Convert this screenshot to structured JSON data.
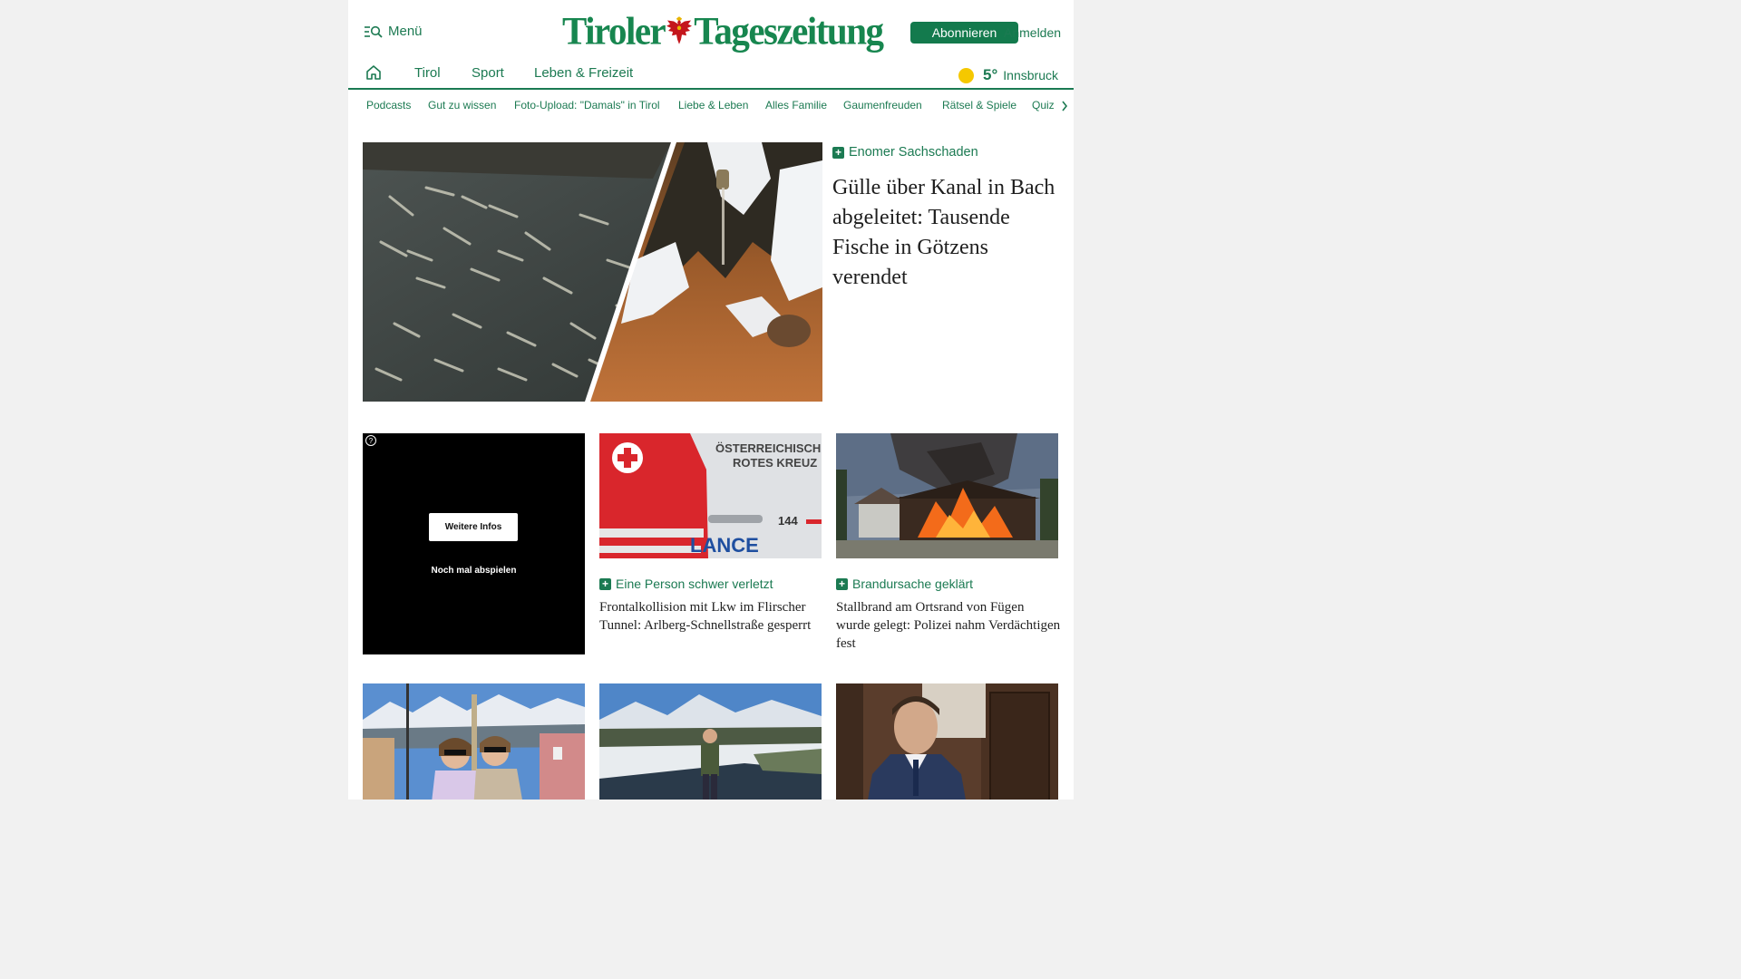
{
  "header": {
    "menu_label": "Menü",
    "logo_part1": "Tiroler",
    "logo_part2": "Tageszeitung",
    "subscribe_label": "Abonnieren",
    "login_label": "Anmelden"
  },
  "nav": {
    "items": [
      "Tirol",
      "Sport",
      "Leben & Freizeit"
    ],
    "weather_temp": "5°",
    "weather_city": "Innsbruck"
  },
  "subnav": {
    "items": [
      "Podcasts",
      "Gut zu wissen",
      "Foto-Upload: \"Damals\" in Tirol",
      "Liebe & Leben",
      "Alles Familie",
      "Gaumenfreuden",
      "Rätsel & Spiele",
      "Quiz"
    ]
  },
  "hero": {
    "kicker": "Enomer Sachschaden",
    "title": "Gülle über Kanal in Bach abgeleitet: Tausende Fische in Götzens verendet"
  },
  "video": {
    "more_info": "Weitere Infos",
    "replay": "Noch mal abspielen"
  },
  "cards": [
    {
      "kicker": "Eine Person schwer verletzt",
      "title": "Frontalkollision mit Lkw im Flirscher Tunnel: Arlberg-Schnellstraße gesperrt",
      "image_text_1": "ÖSTERREICHISCHE",
      "image_text_2": "ROTES KREUZ",
      "image_text_3": "144",
      "image_text_4": "LANCE"
    },
    {
      "kicker": "Brandursache geklärt",
      "title": "Stallbrand am Ortsrand von Fügen wurde gelegt: Polizei nahm Verdächtigen fest"
    }
  ],
  "colors": {
    "brand_green": "#137a4d",
    "logo_green": "#17864f",
    "sun_yellow": "#f5c800"
  }
}
